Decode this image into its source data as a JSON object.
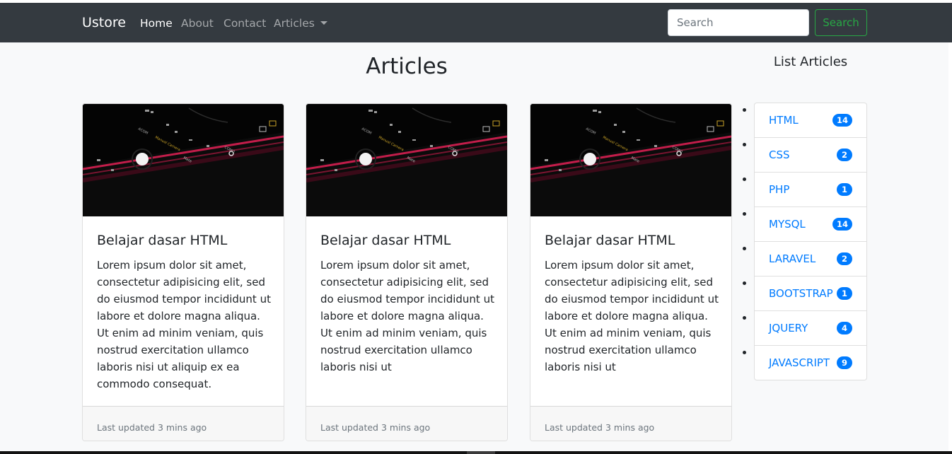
{
  "navbar": {
    "brand": "Ustore",
    "links": [
      {
        "label": "Home",
        "active": true
      },
      {
        "label": "About",
        "active": false
      },
      {
        "label": "Contact",
        "active": false
      },
      {
        "label": "Articles",
        "active": false,
        "dropdown": true
      }
    ],
    "search": {
      "placeholder": "Search",
      "value": "",
      "button_label": "Search"
    }
  },
  "main": {
    "title": "Articles",
    "cards": [
      {
        "title": "Belajar dasar HTML",
        "text": "Lorem ipsum dolor sit amet, consectetur adipisicing elit, sed do eiusmod tempor incididunt ut labore et dolore magna aliqua. Ut enim ad minim veniam, quis nostrud exercitation ullamco laboris nisi ut aliquip ex ea commodo consequat.",
        "footer": "Last updated 3 mins ago"
      },
      {
        "title": "Belajar dasar HTML",
        "text": "Lorem ipsum dolor sit amet, consectetur adipisicing elit, sed do eiusmod tempor incididunt ut labore et dolore magna aliqua. Ut enim ad minim veniam, quis nostrud exercitation ullamco laboris nisi ut",
        "footer": "Last updated 3 mins ago"
      },
      {
        "title": "Belajar dasar HTML",
        "text": "Lorem ipsum dolor sit amet, consectetur adipisicing elit, sed do eiusmod tempor incididunt ut labore et dolore magna aliqua. Ut enim ad minim veniam, quis nostrud exercitation ullamco laboris nisi ut",
        "footer": "Last updated 3 mins ago"
      }
    ],
    "card_image": {
      "icon": "phone-camera-photo",
      "labels": [
        "ACOM",
        "Manual Camera",
        "Mate",
        "COMO"
      ]
    }
  },
  "sidebar": {
    "title": "List Articles",
    "items": [
      {
        "label": "HTML",
        "count": "14"
      },
      {
        "label": "CSS",
        "count": "2"
      },
      {
        "label": "PHP",
        "count": "1"
      },
      {
        "label": "MYSQL",
        "count": "14"
      },
      {
        "label": "LARAVEL",
        "count": "2"
      },
      {
        "label": "BOOTSTRAP",
        "count": "1"
      },
      {
        "label": "JQUERY",
        "count": "4"
      },
      {
        "label": "JAVASCRIPT",
        "count": "9"
      }
    ]
  },
  "colors": {
    "navbar": "#343a40",
    "primary": "#007bff",
    "success": "#28a745",
    "page_background": "#f8f9fa"
  }
}
